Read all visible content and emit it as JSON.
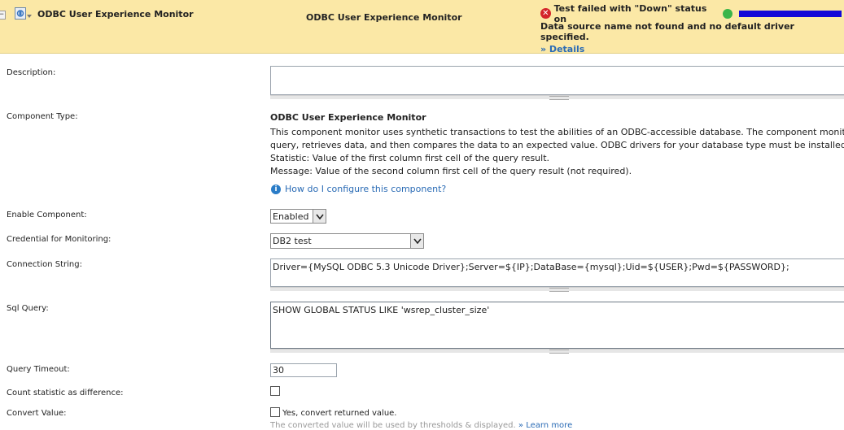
{
  "header": {
    "title": "ODBC User Experience Monitor",
    "center_title": "ODBC User Experience Monitor",
    "status_text": "Test failed with \"Down\" status on",
    "status_message": "Data source name not found and no default driver specified.",
    "details_link": "» Details",
    "colors": {
      "background": "#fbe8a6",
      "error": "#d4252a",
      "node_up": "#3bb54a",
      "link": "#2a6bb5"
    }
  },
  "form": {
    "description": {
      "label": "Description:",
      "value": ""
    },
    "component_type": {
      "label": "Component Type:",
      "title": "ODBC User Experience Monitor",
      "lines": [
        "This component monitor uses synthetic transactions to test the abilities of an ODBC-accessible database. The component monitor co",
        "query, retrieves data, and then compares the data to an expected value. ODBC drivers for your database type must be installed on th",
        "Statistic: Value of the first column first cell of the query result.",
        "Message: Value of the second column first cell of the query result (not required)."
      ],
      "help_link": "How do I configure this component?"
    },
    "enable_component": {
      "label": "Enable Component:",
      "value": "Enabled"
    },
    "credential": {
      "label": "Credential for Monitoring:",
      "value": "DB2 test"
    },
    "connection_string": {
      "label": "Connection String:",
      "value": "Driver={MySQL ODBC 5.3 Unicode Driver};Server=${IP};DataBase={mysql};Uid=${USER};Pwd=${PASSWORD};"
    },
    "sql_query": {
      "label": "Sql Query:",
      "value": "SHOW GLOBAL STATUS LIKE 'wsrep_cluster_size'"
    },
    "query_timeout": {
      "label": "Query Timeout:",
      "value": "30"
    },
    "count_statistic": {
      "label": "Count statistic as difference:",
      "checked": false
    },
    "convert_value": {
      "label": "Convert Value:",
      "checkbox_label": "Yes, convert returned value.",
      "checked": false
    },
    "convert_note": "The converted value will be used by thresholds & displayed.",
    "learn_more": "» Learn more"
  },
  "icons": [
    "collapse-icon",
    "component-icon",
    "error-icon",
    "node-status-icon",
    "info-icon",
    "dropdown-arrow-icon",
    "resize-grip-icon"
  ]
}
